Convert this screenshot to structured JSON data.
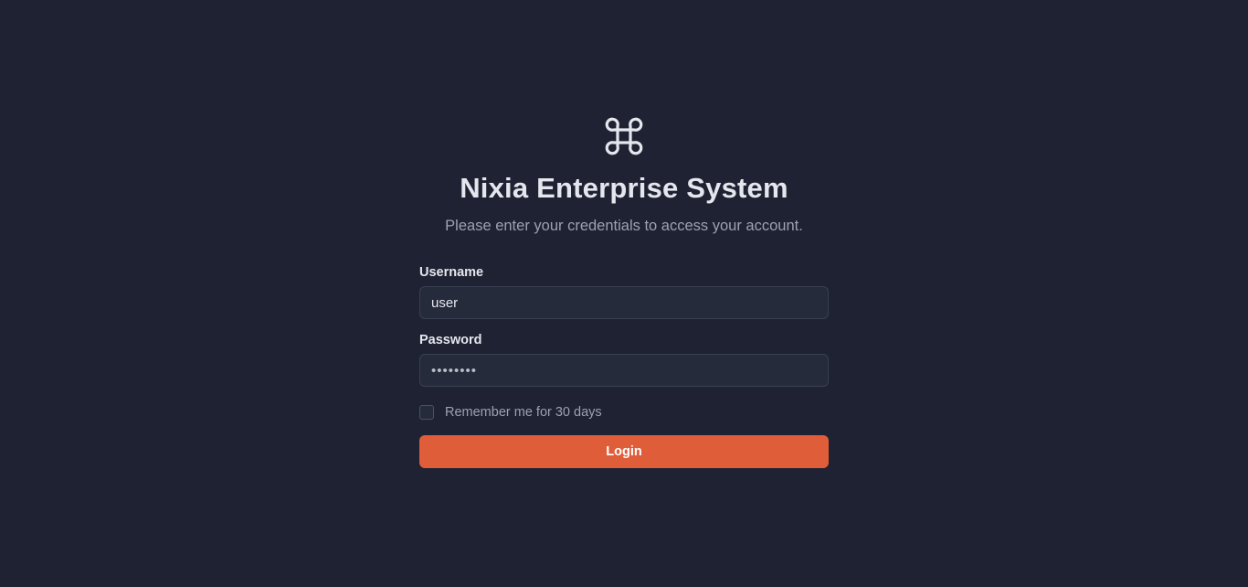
{
  "app": {
    "logo_icon": "command-key-icon",
    "title": "Nixia Enterprise System",
    "subtitle": "Please enter your credentials to access your account."
  },
  "form": {
    "username": {
      "label": "Username",
      "value": "user"
    },
    "password": {
      "label": "Password",
      "value": "••••••••"
    },
    "remember": {
      "label": "Remember me for 30 days",
      "checked": false
    },
    "submit_label": "Login"
  },
  "colors": {
    "background": "#1e2232",
    "input_background": "#262b3b",
    "accent": "#e05d3a",
    "text_primary": "#e5e7ee",
    "text_secondary": "#9ca2b3"
  }
}
